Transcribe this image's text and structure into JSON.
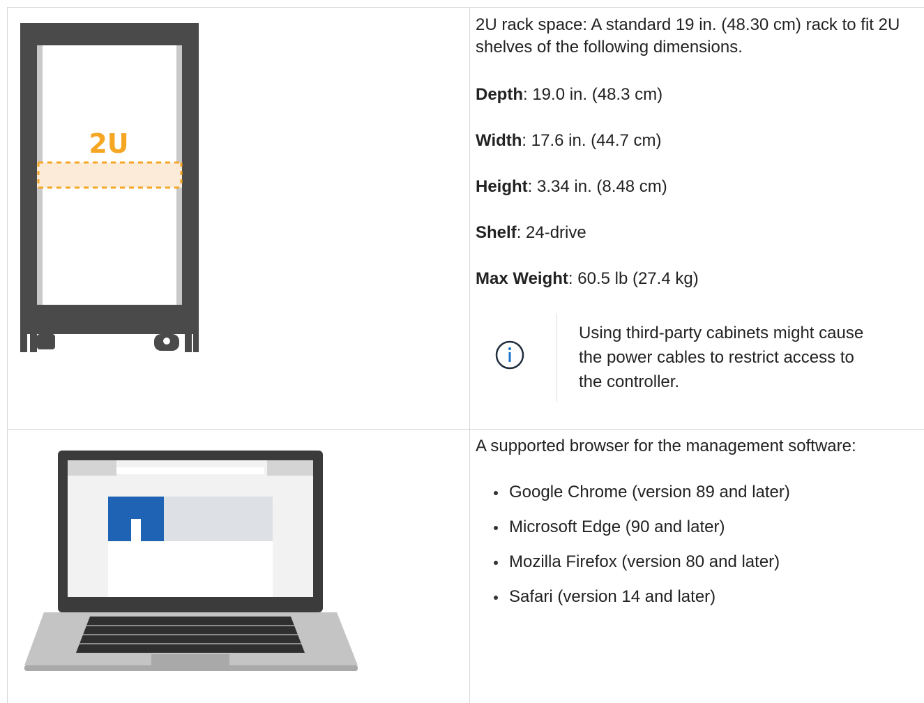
{
  "rack_row": {
    "illustration": {
      "label": "2U",
      "icon": "server-rack-icon",
      "colors": {
        "frame": "#4a4a4a",
        "highlight": "#f5a623",
        "band_fill": "#fcebd8"
      }
    },
    "intro": "2U rack space: A standard 19 in. (48.30 cm) rack to fit 2U shelves of the following dimensions.",
    "specs": [
      {
        "label": "Depth",
        "value": ": 19.0 in. (48.3 cm)"
      },
      {
        "label": "Width",
        "value": ": 17.6 in. (44.7 cm)"
      },
      {
        "label": "Height",
        "value": ": 3.34 in. (8.48 cm)"
      },
      {
        "label": "Shelf",
        "value": ": 24-drive"
      },
      {
        "label": "Max Weight",
        "value": ": 60.5 lb (27.4 kg)"
      }
    ],
    "note": {
      "icon": "info-icon",
      "text": "Using third-party cabinets might cause the power cables to restrict access to the controller."
    }
  },
  "browser_row": {
    "illustration": {
      "icon": "laptop-icon",
      "colors": {
        "logo": "#1f63b4",
        "screen_bezel": "#3b3b3b",
        "body": "#c4c4c4"
      }
    },
    "intro": "A supported browser for the management software:",
    "browsers": [
      "Google Chrome (version 89 and later)",
      "Microsoft Edge (90 and later)",
      "Mozilla Firefox (version 80 and later)",
      "Safari (version 14 and later)"
    ]
  }
}
